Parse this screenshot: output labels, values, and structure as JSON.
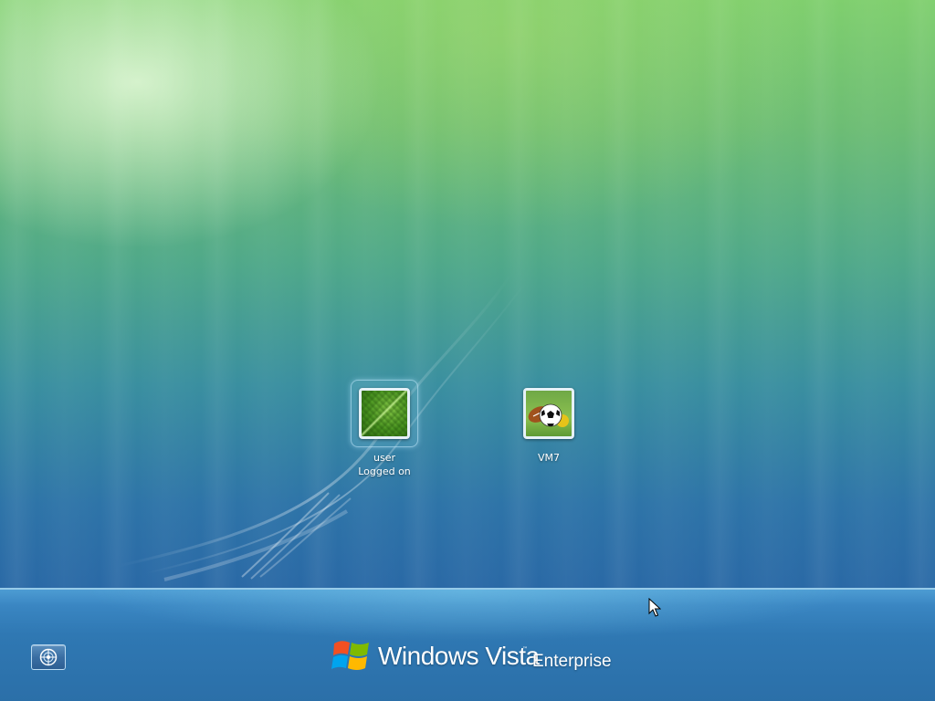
{
  "accounts": [
    {
      "name": "user",
      "status": "Logged on",
      "selected": true,
      "picture_icon": "green-leaf-picture-icon"
    },
    {
      "name": "VM7",
      "status": "",
      "selected": false,
      "picture_icon": "sports-balls-picture-icon"
    }
  ],
  "ease_of_access": {
    "icon": "ease-of-access-icon"
  },
  "branding": {
    "windows": "Windows Vista",
    "trademark": "™",
    "edition": "Enterprise",
    "flag_colors": [
      "#f25022",
      "#7fba00",
      "#00a4ef",
      "#ffb900"
    ]
  },
  "pointer": {
    "icon": "mouse-pointer-icon"
  }
}
